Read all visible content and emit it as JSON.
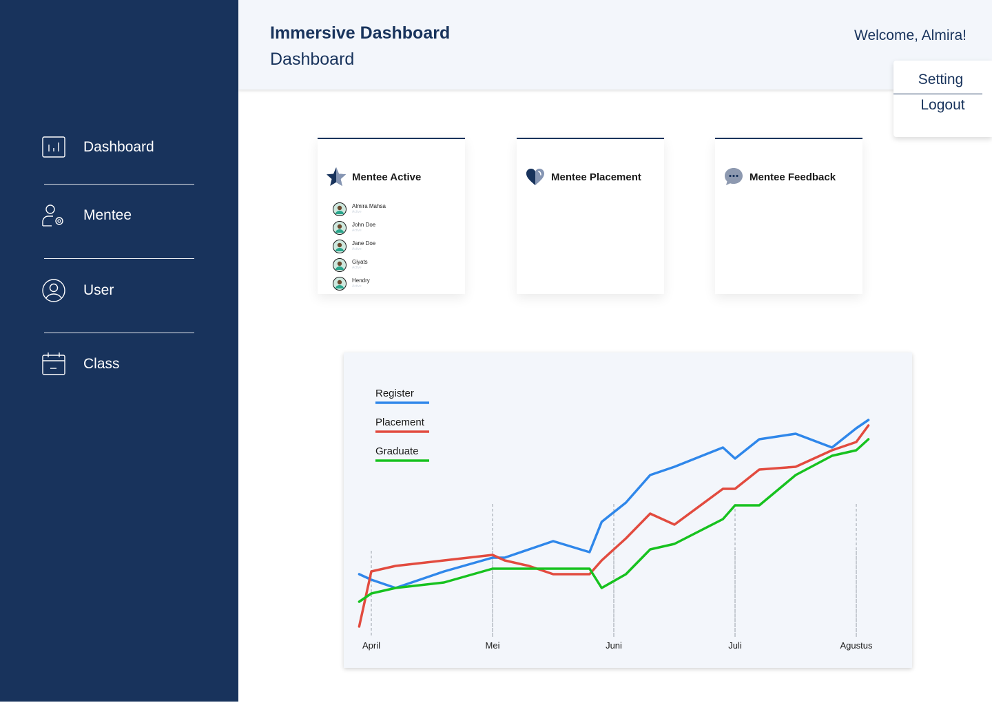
{
  "sidebar": {
    "items": [
      {
        "label": "Dashboard",
        "icon": "chart-icon"
      },
      {
        "label": "Mentee",
        "icon": "user-gear-icon"
      },
      {
        "label": "User",
        "icon": "user-circle-icon"
      },
      {
        "label": "Class",
        "icon": "calendar-icon"
      }
    ]
  },
  "header": {
    "app_title": "Immersive Dashboard",
    "page_title": "Dashboard",
    "welcome": "Welcome, Almira!"
  },
  "user_menu": {
    "items": [
      "Setting",
      "Logout"
    ]
  },
  "cards": [
    {
      "title": "Mentee Active",
      "icon": "star-icon",
      "mentees": [
        {
          "name": "Almira Mahsa",
          "status": "Active"
        },
        {
          "name": "John Doe",
          "status": "Active"
        },
        {
          "name": "Jane Doe",
          "status": "Active"
        },
        {
          "name": "Giyats",
          "status": "Active"
        },
        {
          "name": "Hendry",
          "status": "Active"
        }
      ]
    },
    {
      "title": "Mentee Placement",
      "icon": "heart-icon"
    },
    {
      "title": "Mentee Feedback",
      "icon": "chat-bubble-icon"
    }
  ],
  "colors": {
    "sidebar": "#18335c",
    "register": "#2f87ea",
    "placement": "#e24b3f",
    "graduate": "#17c21f"
  },
  "chart_data": {
    "type": "line",
    "categories": [
      "April",
      "Mei",
      "Juni",
      "Juli",
      "Agustus"
    ],
    "x": [
      -0.1,
      0,
      0.2,
      0.6,
      1,
      1.1,
      1.3,
      1.5,
      1.8,
      1.9,
      2.1,
      2.3,
      2.5,
      2.9,
      3,
      3.2,
      3.5,
      3.8,
      4,
      4.1
    ],
    "series": [
      {
        "name": "Register",
        "color": "#2f87ea",
        "values": [
          22,
          20,
          17,
          23,
          28,
          28,
          31,
          34,
          30,
          41,
          48,
          58,
          61,
          68,
          64,
          71,
          73,
          68,
          75,
          78
        ]
      },
      {
        "name": "Placement",
        "color": "#e24b3f",
        "values": [
          3,
          23,
          25,
          27,
          29,
          27,
          25,
          22,
          22,
          27,
          35,
          44,
          40,
          53,
          53,
          60,
          61,
          67,
          70,
          76
        ]
      },
      {
        "name": "Graduate",
        "color": "#17c21f",
        "values": [
          12,
          15,
          17,
          19,
          24,
          24,
          24,
          24,
          24,
          17,
          22,
          31,
          33,
          42,
          47,
          47,
          58,
          65,
          67,
          71
        ]
      }
    ],
    "ylim": [
      0,
      100
    ],
    "grid": "vertical dashed at categories",
    "legend": "top-left"
  }
}
